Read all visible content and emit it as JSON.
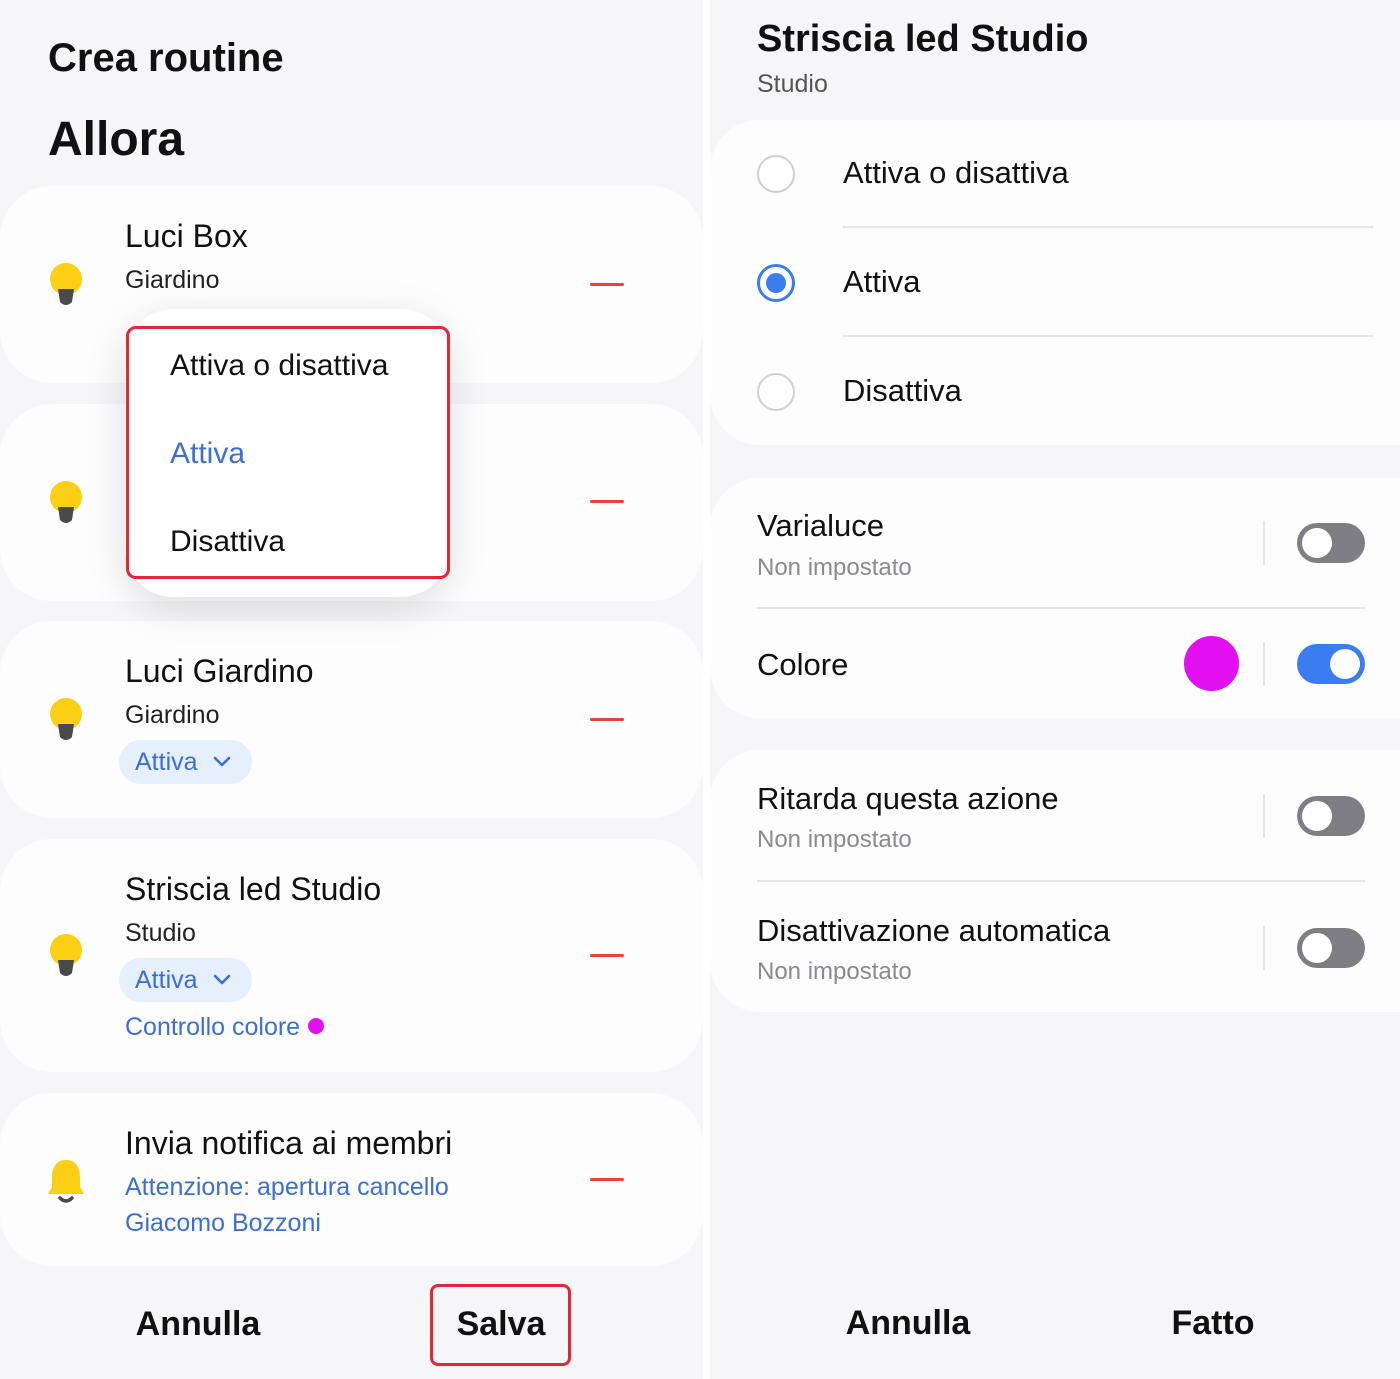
{
  "left": {
    "title": "Crea routine",
    "section": "Allora",
    "cards": [
      {
        "name": "Luci Box",
        "room": "Giardino"
      },
      {
        "name": "",
        "room": ""
      },
      {
        "name": "Luci Giardino",
        "room": "Giardino",
        "chip": "Attiva"
      },
      {
        "name": "Striscia led Studio",
        "room": "Studio",
        "chip": "Attiva",
        "link": "Controllo colore"
      },
      {
        "name": "Invia notifica ai membri",
        "line1": "Attenzione: apertura cancello",
        "line2": "Giacomo Bozzoni"
      }
    ],
    "dropdown": {
      "items": [
        "Attiva o disattiva",
        "Attiva",
        "Disattiva"
      ],
      "selected": "Attiva"
    },
    "buttons": {
      "cancel": "Annulla",
      "save": "Salva"
    }
  },
  "right": {
    "title": "Striscia led Studio",
    "subtitle": "Studio",
    "radio_options": [
      "Attiva o disattiva",
      "Attiva",
      "Disattiva"
    ],
    "radio_selected": "Attiva",
    "settings": {
      "dimmer": {
        "label": "Varialuce",
        "value": "Non impostato",
        "enabled": false
      },
      "color": {
        "label": "Colore",
        "enabled": true
      },
      "delay": {
        "label": "Ritarda questa azione",
        "value": "Non impostato",
        "enabled": false
      },
      "auto_off": {
        "label": "Disattivazione automatica",
        "value": "Non impostato",
        "enabled": false
      }
    },
    "buttons": {
      "cancel": "Annulla",
      "done": "Fatto"
    }
  },
  "colors": {
    "accent": "#3b7cf0",
    "link": "#3b6fd6",
    "selected_color": "#e20ff0",
    "remove": "#e8433b",
    "highlight": "#e02836",
    "bulb": "#fbcf14"
  },
  "icons": {
    "device": "lightbulb-icon",
    "notification": "bell-icon",
    "remove": "minus-icon",
    "chip": "chevron-down-icon"
  }
}
